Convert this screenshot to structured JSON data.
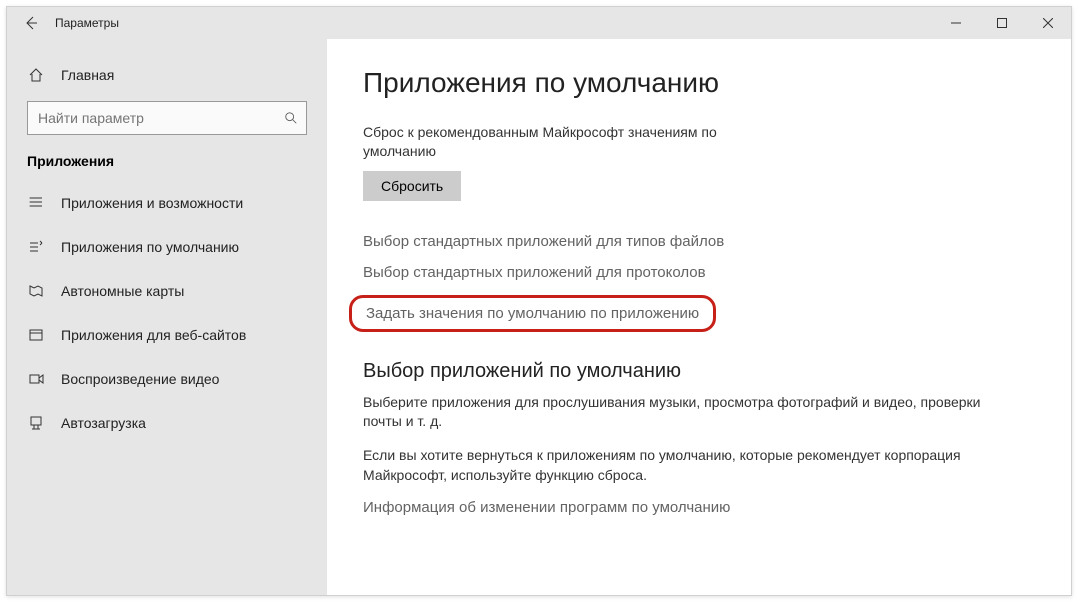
{
  "window": {
    "title": "Параметры"
  },
  "sidebar": {
    "home_label": "Главная",
    "search_placeholder": "Найти параметр",
    "section_label": "Приложения",
    "items": [
      {
        "label": "Приложения и возможности"
      },
      {
        "label": "Приложения по умолчанию"
      },
      {
        "label": "Автономные карты"
      },
      {
        "label": "Приложения для веб-сайтов"
      },
      {
        "label": "Воспроизведение видео"
      },
      {
        "label": "Автозагрузка"
      }
    ]
  },
  "main": {
    "title": "Приложения по умолчанию",
    "reset_description": "Сброс к рекомендованным Майкрософт значениям по умолчанию",
    "reset_button": "Сбросить",
    "links": [
      "Выбор стандартных приложений для типов файлов",
      "Выбор стандартных приложений для протоколов",
      "Задать значения по умолчанию по приложению"
    ],
    "section2_title": "Выбор приложений по умолчанию",
    "section2_p1": "Выберите приложения для прослушивания музыки, просмотра фотографий и видео, проверки почты и т. д.",
    "section2_p2": "Если вы хотите вернуться к приложениям по умолчанию, которые рекомендует корпорация Майкрософт, используйте функцию сброса.",
    "section2_link": "Информация об изменении программ по умолчанию"
  }
}
